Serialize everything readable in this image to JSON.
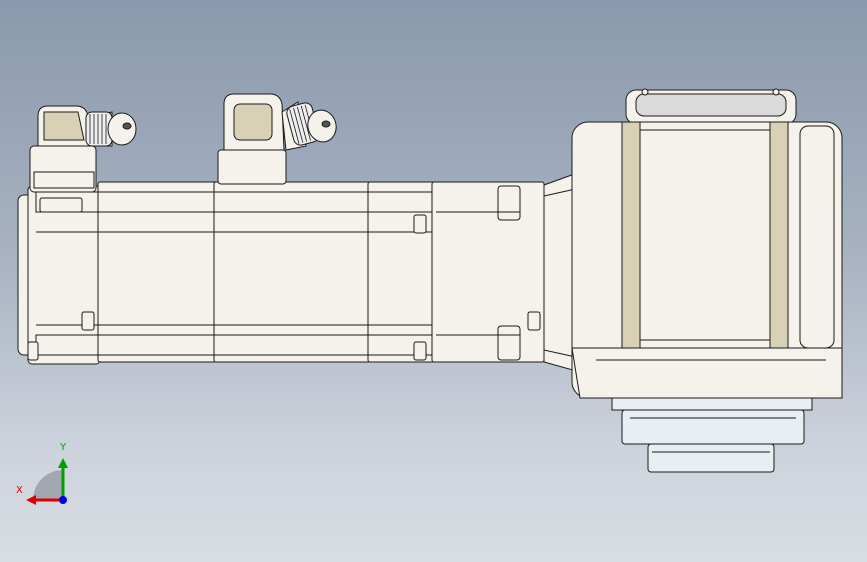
{
  "triad": {
    "x_label": "X",
    "y_label": "Y",
    "colors": {
      "x": "#e00000",
      "y": "#00a000",
      "z": "#0000e0",
      "wedge": "#9aa0a8"
    }
  },
  "model_colors": {
    "body": "#f4f2ea",
    "shade": "#d9d1b6",
    "edge": "#1a1a1a",
    "connector": "#eeeeee",
    "flange": "#e8eef2"
  },
  "parts": [
    "motor-body",
    "encoder-connector",
    "power-connector",
    "gearbox-housing",
    "output-flange",
    "output-shaft"
  ]
}
